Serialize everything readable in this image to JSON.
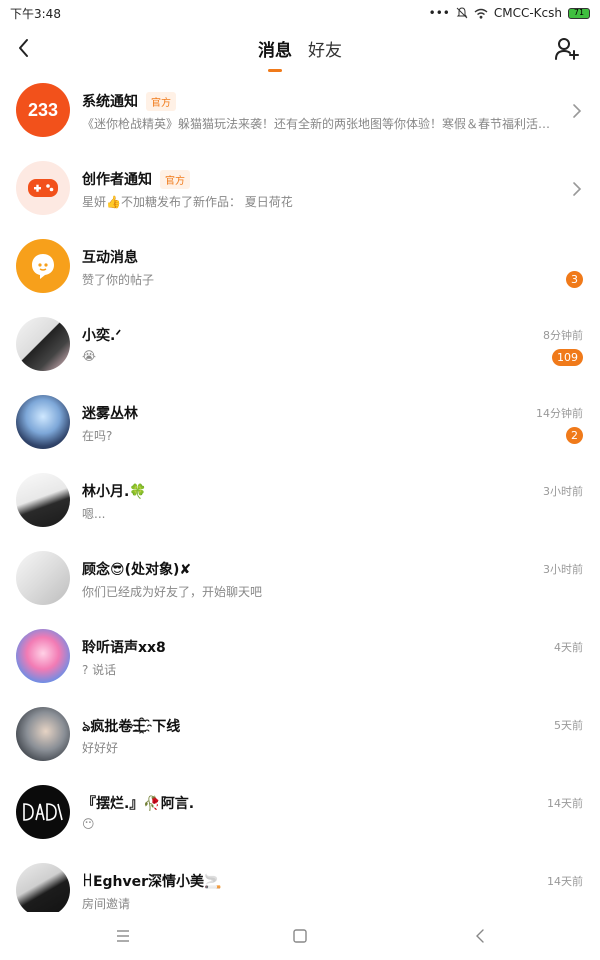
{
  "status_bar": {
    "time": "下午3:48",
    "carrier": "CMCC-Kcsh",
    "battery": "71",
    "icons": [
      "more-dots-icon",
      "mute-bell-icon",
      "wifi-icon",
      "battery-icon"
    ]
  },
  "header": {
    "tabs": [
      {
        "label": "消息",
        "active": true
      },
      {
        "label": "好友",
        "active": false
      }
    ],
    "icons": [
      "back-arrow-icon",
      "add-friend-icon"
    ]
  },
  "accent_color": "#f07a1a",
  "messages": [
    {
      "name": "系统通知",
      "official_tag": "官方",
      "preview": "《迷你枪战精英》躲猫猫玩法来袭！还有全新的两张地图等你体验！寒假＆春节福利活动送…",
      "time": "",
      "badge": "",
      "avatar_text": "233",
      "chevron": true
    },
    {
      "name": "创作者通知",
      "official_tag": "官方",
      "preview": "星妍👍不加糖发布了新作品： 夏日荷花",
      "time": "",
      "badge": "",
      "chevron": true
    },
    {
      "name": "互动消息",
      "official_tag": "",
      "preview": "赞了你的帖子",
      "time": "",
      "badge": "3"
    },
    {
      "name": "小奕.ᐟ",
      "official_tag": "",
      "preview": "😭",
      "time": "8分钟前",
      "badge": "109"
    },
    {
      "name": "迷雾丛林",
      "official_tag": "",
      "preview": "在吗?",
      "time": "14分钟前",
      "badge": "2"
    },
    {
      "name": "林小月.🍀",
      "official_tag": "",
      "preview": "嗯...",
      "time": "3小时前",
      "badge": ""
    },
    {
      "name": "顾念😎(处对象)✘",
      "official_tag": "",
      "preview": "你们已经成为好友了，开始聊天吧",
      "time": "3小时前",
      "badge": ""
    },
    {
      "name": "聆听语声xx8",
      "official_tag": "",
      "preview": "? 说话",
      "time": "4天前",
      "badge": ""
    },
    {
      "name": "ঌ疯批卷王҈下线",
      "official_tag": "",
      "preview": "好好好",
      "time": "5天前",
      "badge": ""
    },
    {
      "name": "『摆烂.』🥀阿言.",
      "official_tag": "",
      "preview": "😶",
      "time": "14天前",
      "badge": ""
    },
    {
      "name": "ꀿEghver深情小美🚬",
      "official_tag": "",
      "preview": "房间邀请",
      "time": "14天前",
      "badge": ""
    }
  ],
  "nav_bar": {
    "icons": [
      "menu-icon",
      "home-square-icon",
      "back-icon"
    ]
  }
}
